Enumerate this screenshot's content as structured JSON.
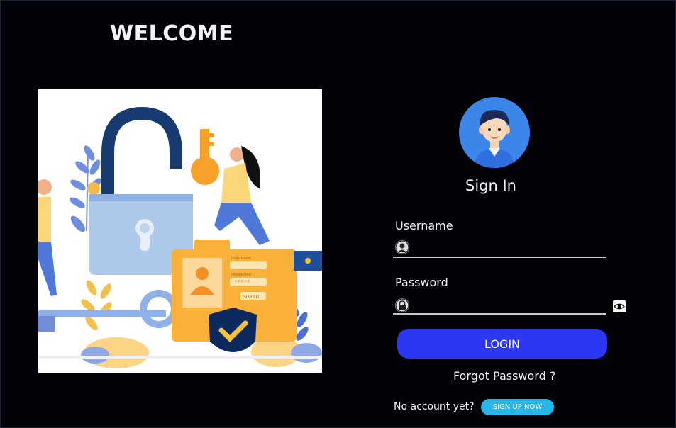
{
  "page": {
    "welcome_title": "WELCOME"
  },
  "login_form": {
    "title": "Sign In",
    "username_label": "Username",
    "username_value": "",
    "password_label": "Password",
    "password_value": "",
    "login_button": "LOGIN",
    "forgot_link": "Forgot Password ?",
    "no_account_text": "No account yet?",
    "signup_button": "SIGN UP NOW"
  },
  "illustration": {
    "form_card_labels": [
      "USERNAME :",
      "PASSWORD :",
      "SUBMIT"
    ],
    "password_mask": "*****"
  },
  "icons": {
    "avatar": "user-avatar-icon",
    "username_field": "user-icon",
    "password_field": "lock-icon",
    "show_password": "eye-icon"
  },
  "colors": {
    "background": "#020208",
    "login_button": "#2b37f2",
    "signup_button": "#29b6e6",
    "avatar_bg": "#3b86e8"
  }
}
